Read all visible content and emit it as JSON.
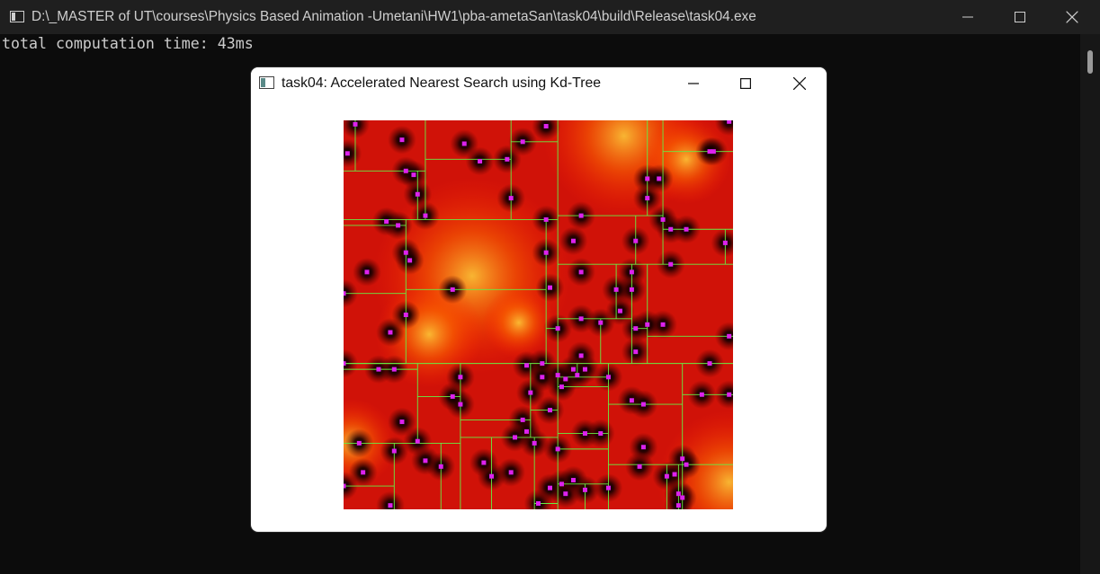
{
  "console": {
    "title": "D:\\_MASTER of UT\\courses\\Physics Based Animation -Umetani\\HW1\\pba-ametaSan\\task04\\build\\Release\\task04.exe",
    "output_line": "total computation time: 43ms"
  },
  "gl_window": {
    "title": "task04: Accelerated Nearest Search using Kd-Tree"
  },
  "colors": {
    "console_bg": "#0c0c0c",
    "split_line": "#66ee44",
    "point": "#dd22ee"
  },
  "kdtree_visualization": {
    "points_per_canvas": [
      [
        0.03,
        0.01
      ],
      [
        0.99,
        0.003
      ],
      [
        0.01,
        0.085
      ],
      [
        0.15,
        0.05
      ],
      [
        0.31,
        0.06
      ],
      [
        0.46,
        0.055
      ],
      [
        0.52,
        0.015
      ],
      [
        0.35,
        0.105
      ],
      [
        0.42,
        0.1
      ],
      [
        0.95,
        0.08
      ],
      [
        0.94,
        0.08
      ],
      [
        0.16,
        0.13
      ],
      [
        0.18,
        0.14
      ],
      [
        0.78,
        0.15
      ],
      [
        0.81,
        0.15
      ],
      [
        0.19,
        0.19
      ],
      [
        0.78,
        0.2
      ],
      [
        0.43,
        0.2
      ],
      [
        0.14,
        0.27
      ],
      [
        0.11,
        0.26
      ],
      [
        0.21,
        0.245
      ],
      [
        0.61,
        0.245
      ],
      [
        0.52,
        0.255
      ],
      [
        0.82,
        0.255
      ],
      [
        0.84,
        0.28
      ],
      [
        0.88,
        0.28
      ],
      [
        0.98,
        0.315
      ],
      [
        0.59,
        0.31
      ],
      [
        0.75,
        0.31
      ],
      [
        0.16,
        0.34
      ],
      [
        0.17,
        0.36
      ],
      [
        0.52,
        0.34
      ],
      [
        0.84,
        0.37
      ],
      [
        0.06,
        0.39
      ],
      [
        0.61,
        0.39
      ],
      [
        0.74,
        0.39
      ],
      [
        0.28,
        0.435
      ],
      [
        0.53,
        0.43
      ],
      [
        0.0,
        0.445
      ],
      [
        0.74,
        0.435
      ],
      [
        0.7,
        0.435
      ],
      [
        0.16,
        0.5
      ],
      [
        0.71,
        0.49
      ],
      [
        0.66,
        0.52
      ],
      [
        0.61,
        0.51
      ],
      [
        0.55,
        0.535
      ],
      [
        0.82,
        0.525
      ],
      [
        0.78,
        0.525
      ],
      [
        0.75,
        0.535
      ],
      [
        0.12,
        0.545
      ],
      [
        0.99,
        0.555
      ],
      [
        0.75,
        0.595
      ],
      [
        0.61,
        0.605
      ],
      [
        0.0,
        0.625
      ],
      [
        0.51,
        0.625
      ],
      [
        0.47,
        0.63
      ],
      [
        0.94,
        0.625
      ],
      [
        0.09,
        0.64
      ],
      [
        0.13,
        0.64
      ],
      [
        0.59,
        0.64
      ],
      [
        0.62,
        0.64
      ],
      [
        0.55,
        0.655
      ],
      [
        0.6,
        0.655
      ],
      [
        0.57,
        0.665
      ],
      [
        0.51,
        0.66
      ],
      [
        0.68,
        0.66
      ],
      [
        0.56,
        0.685
      ],
      [
        0.3,
        0.66
      ],
      [
        0.48,
        0.7
      ],
      [
        0.74,
        0.72
      ],
      [
        0.53,
        0.745
      ],
      [
        0.77,
        0.73
      ],
      [
        0.3,
        0.73
      ],
      [
        0.28,
        0.71
      ],
      [
        0.92,
        0.705
      ],
      [
        0.99,
        0.705
      ],
      [
        0.46,
        0.77
      ],
      [
        0.47,
        0.8
      ],
      [
        0.15,
        0.775
      ],
      [
        0.44,
        0.815
      ],
      [
        0.62,
        0.805
      ],
      [
        0.49,
        0.83
      ],
      [
        0.55,
        0.845
      ],
      [
        0.66,
        0.805
      ],
      [
        0.77,
        0.84
      ],
      [
        0.19,
        0.825
      ],
      [
        0.21,
        0.875
      ],
      [
        0.13,
        0.85
      ],
      [
        0.04,
        0.83
      ],
      [
        0.87,
        0.87
      ],
      [
        0.85,
        0.91
      ],
      [
        0.88,
        0.885
      ],
      [
        0.25,
        0.89
      ],
      [
        0.38,
        0.915
      ],
      [
        0.43,
        0.905
      ],
      [
        0.05,
        0.905
      ],
      [
        0.56,
        0.935
      ],
      [
        0.68,
        0.945
      ],
      [
        0.76,
        0.89
      ],
      [
        0.83,
        0.915
      ],
      [
        0.86,
        0.96
      ],
      [
        0.53,
        0.945
      ],
      [
        0.57,
        0.96
      ],
      [
        0.62,
        0.95
      ],
      [
        0.5,
        0.985
      ],
      [
        0.12,
        0.99
      ],
      [
        0.0,
        0.94
      ],
      [
        0.59,
        0.925
      ],
      [
        0.36,
        0.88
      ],
      [
        0.87,
        0.97
      ],
      [
        0.86,
        0.99
      ]
    ]
  }
}
